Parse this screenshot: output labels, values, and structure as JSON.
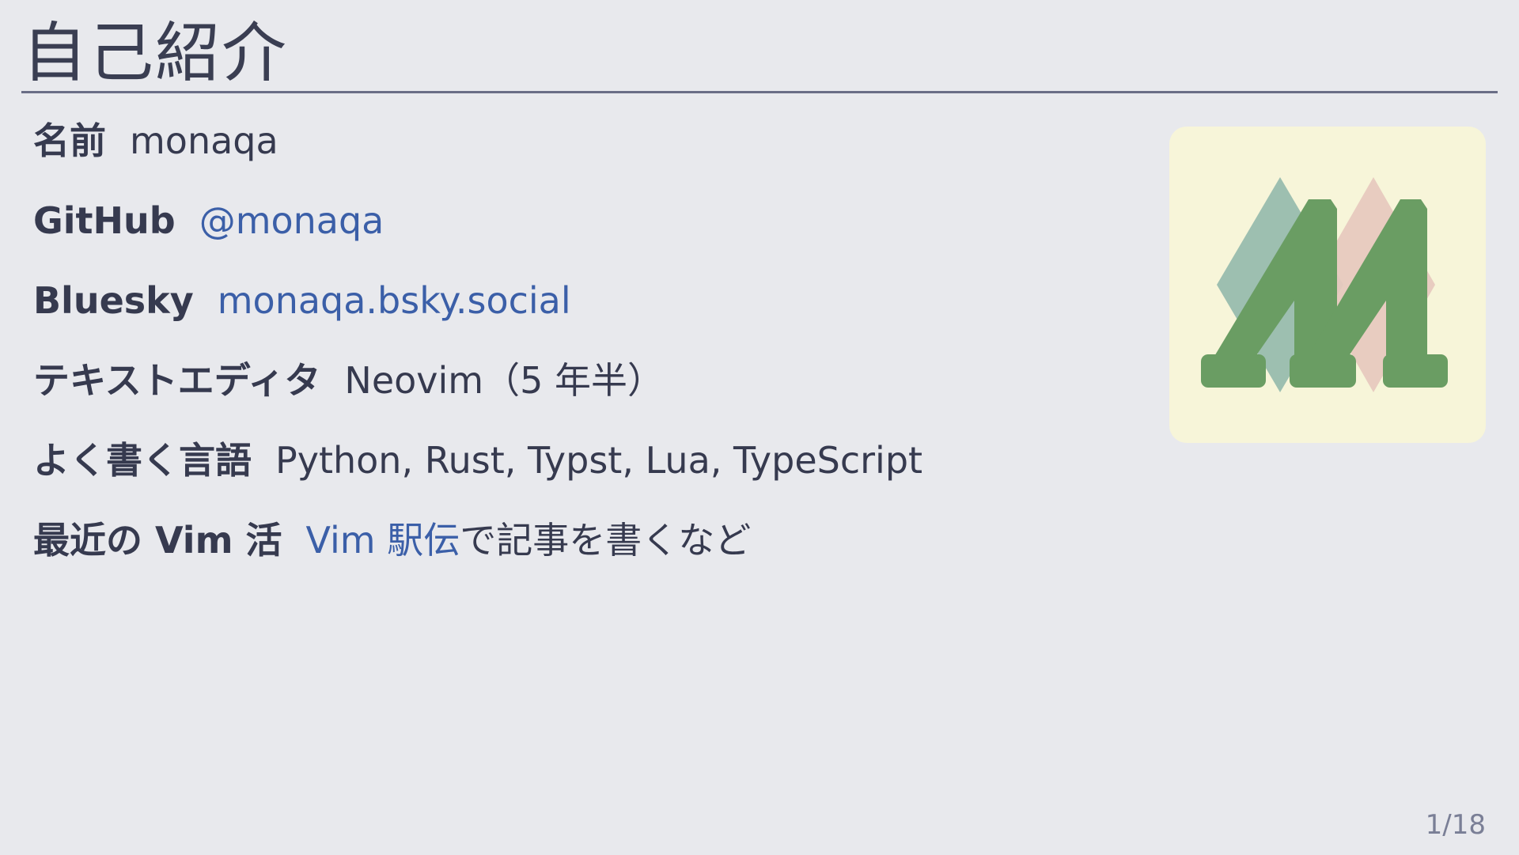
{
  "slide": {
    "title": "自己紹介",
    "page_number": "1/18"
  },
  "profile": {
    "name": {
      "label": "名前",
      "value": "monaqa"
    },
    "github": {
      "label": "GitHub",
      "value": "@monaqa"
    },
    "bluesky": {
      "label": "Bluesky",
      "value": "monaqa.bsky.social"
    },
    "editor": {
      "label": "テキストエディタ",
      "value": "Neovim（5 年半）"
    },
    "languages": {
      "label": "よく書く言語",
      "value": "Python, Rust, Typst, Lua, TypeScript"
    },
    "vim_activity": {
      "label": "最近の Vim 活",
      "link_text": "Vim 駅伝",
      "rest_text": "で記事を書くなど"
    }
  },
  "colors": {
    "background": "#e8e9ed",
    "text": "#363a4f",
    "link": "#3b5fa8",
    "logo_card": "#f7f5d9",
    "logo_green": "#6a9d63",
    "logo_teal": "#98bcae",
    "logo_pink": "#e7c9bf"
  },
  "logo": {
    "icon": "monaqa-m-logo-icon"
  }
}
